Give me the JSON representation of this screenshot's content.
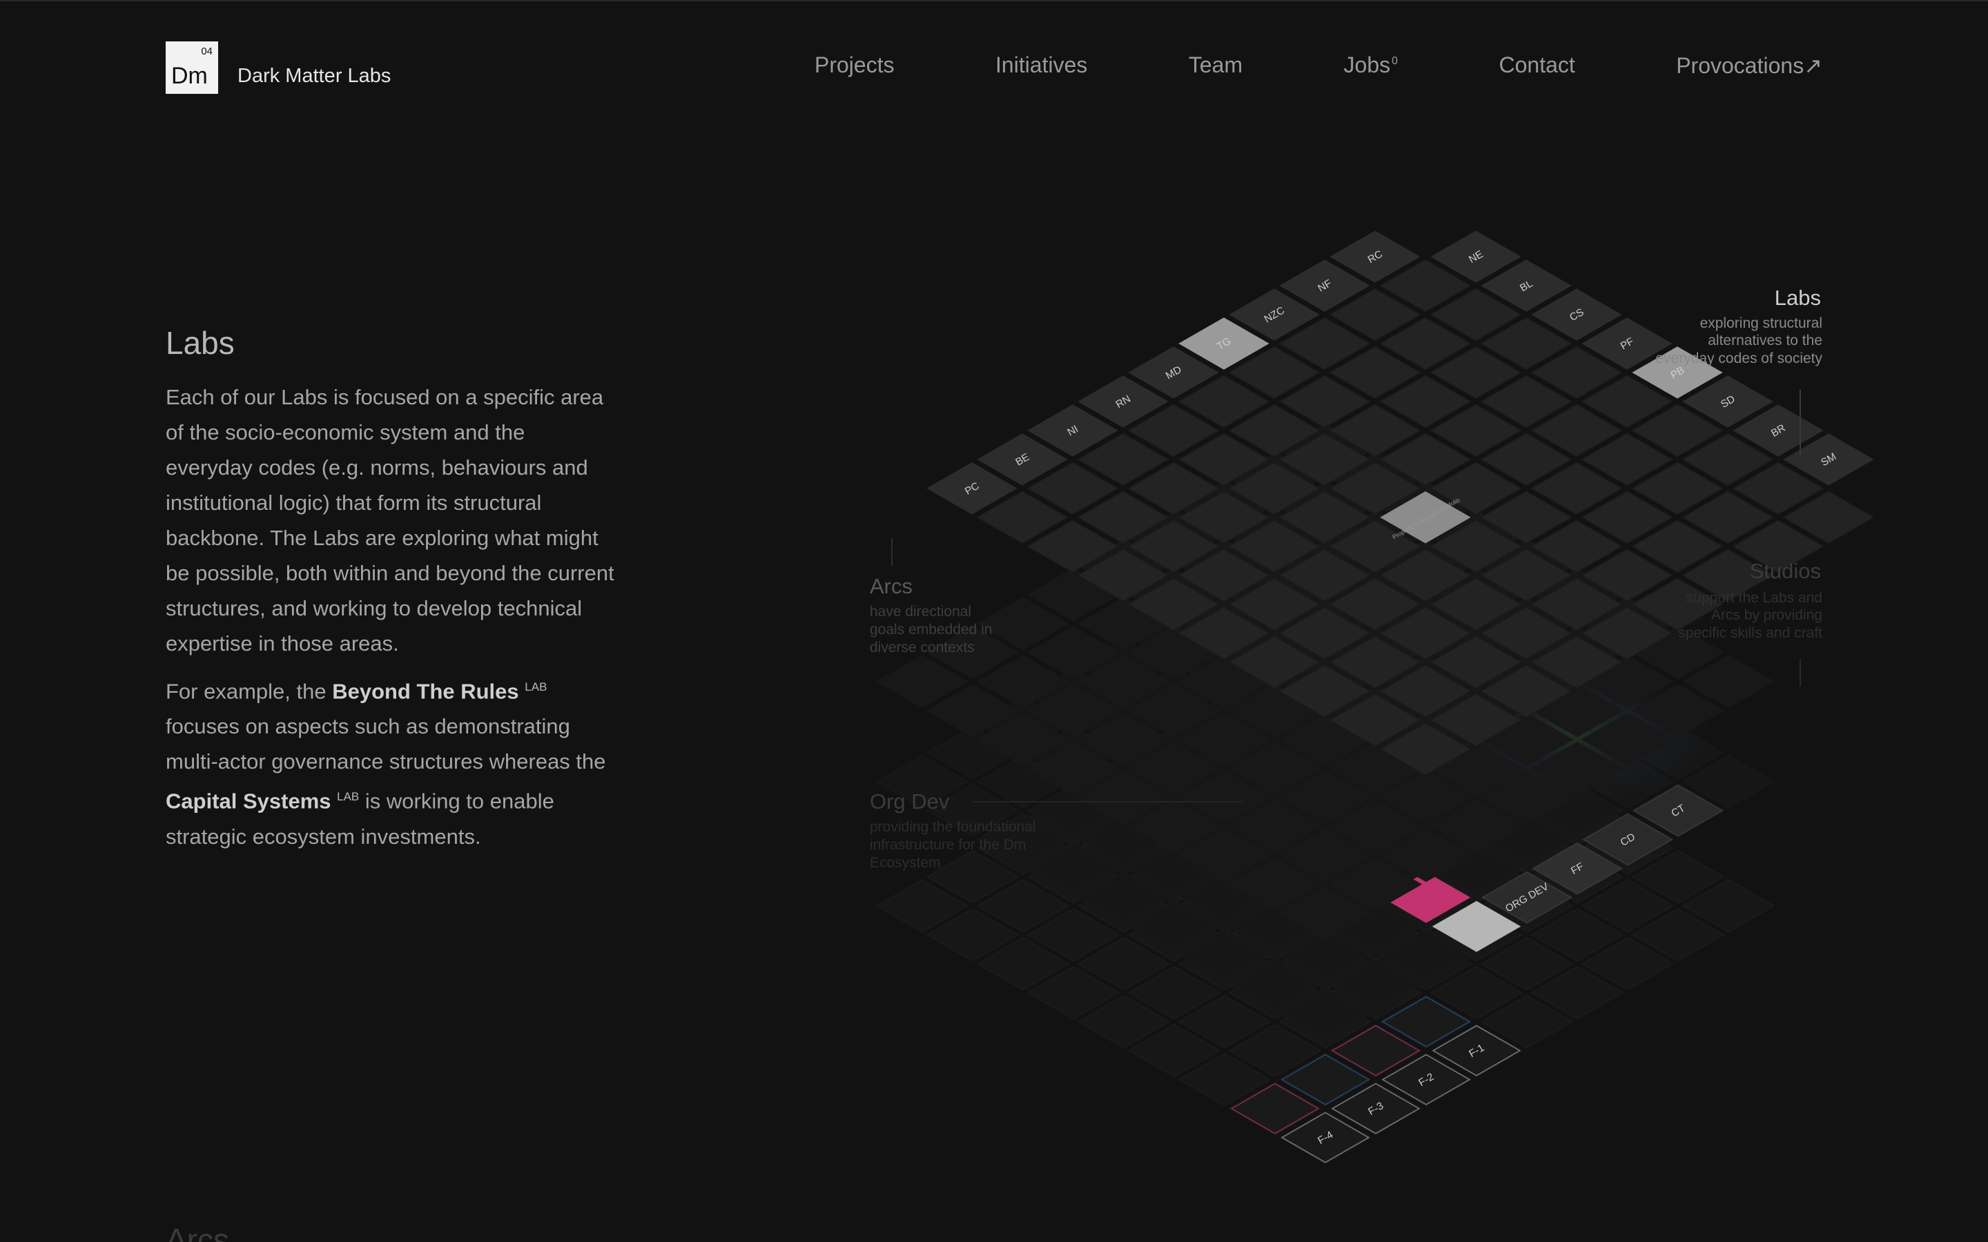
{
  "header": {
    "logo_number": "04",
    "logo_abbr": "Dm",
    "brand": "Dark Matter Labs",
    "nav": [
      {
        "label": "Projects",
        "sup": ""
      },
      {
        "label": "Initiatives",
        "sup": ""
      },
      {
        "label": "Team",
        "sup": ""
      },
      {
        "label": "Jobs",
        "sup": "0"
      },
      {
        "label": "Contact",
        "sup": ""
      },
      {
        "label": "Provocations",
        "sup": "↗"
      }
    ]
  },
  "main": {
    "heading": "Labs",
    "para1": "Each of our Labs is focused on a specific area of the socio-economic system and the everyday codes (e.g. norms, behaviours and institutional logic) that form its structural backbone. The Labs are exploring what might be possible, both within and beyond the current structures, and working to develop technical expertise in those areas.",
    "para2_pre": "For example, the ",
    "para2_lab1": "Beyond The Rules",
    "para2_mid": " focuses on aspects such as demonstrating multi-actor governance structures whereas the ",
    "para2_lab2": "Capital Systems",
    "para2_post": " is working to enable strategic ecosystem investments.",
    "lab_sup": "LAB",
    "next_heading": "Arcs"
  },
  "diagram": {
    "labs": {
      "title": "Labs",
      "sub": [
        "exploring structural",
        "alternatives to the",
        "everyday codes of society"
      ]
    },
    "arcs": {
      "title": "Arcs",
      "sub": [
        "have directional",
        "goals embedded in",
        "diverse contexts"
      ]
    },
    "studios": {
      "title": "Studios",
      "sub": [
        "support the Labs and",
        "Arcs by providing",
        "specific skills and craft"
      ]
    },
    "orgdev": {
      "title": "Org Dev",
      "sub": [
        "providing the foundational",
        "infrastructure for the Dm",
        "Ecosystem"
      ]
    },
    "left_codes": [
      "PC",
      "BE",
      "NI",
      "RN",
      "MD",
      "TG",
      "NZC",
      "NF",
      "RC"
    ],
    "top_codes": [
      "NE",
      "BL",
      "CS",
      "PF",
      "PB",
      "SD",
      "BR",
      "SM"
    ],
    "center_label": "Property & Beyond Portfolio",
    "studio_codes": [
      "CT",
      "CD",
      "FF",
      "ORG DEV"
    ],
    "orgdev_codes": [
      "F-1",
      "F-2",
      "F-3",
      "F-4"
    ],
    "colors": {
      "bg": "#121212",
      "tile": "#242424",
      "tile_light": "#8a8a8a",
      "pink": "#d4367a",
      "blue": "#2f6fb0"
    }
  }
}
